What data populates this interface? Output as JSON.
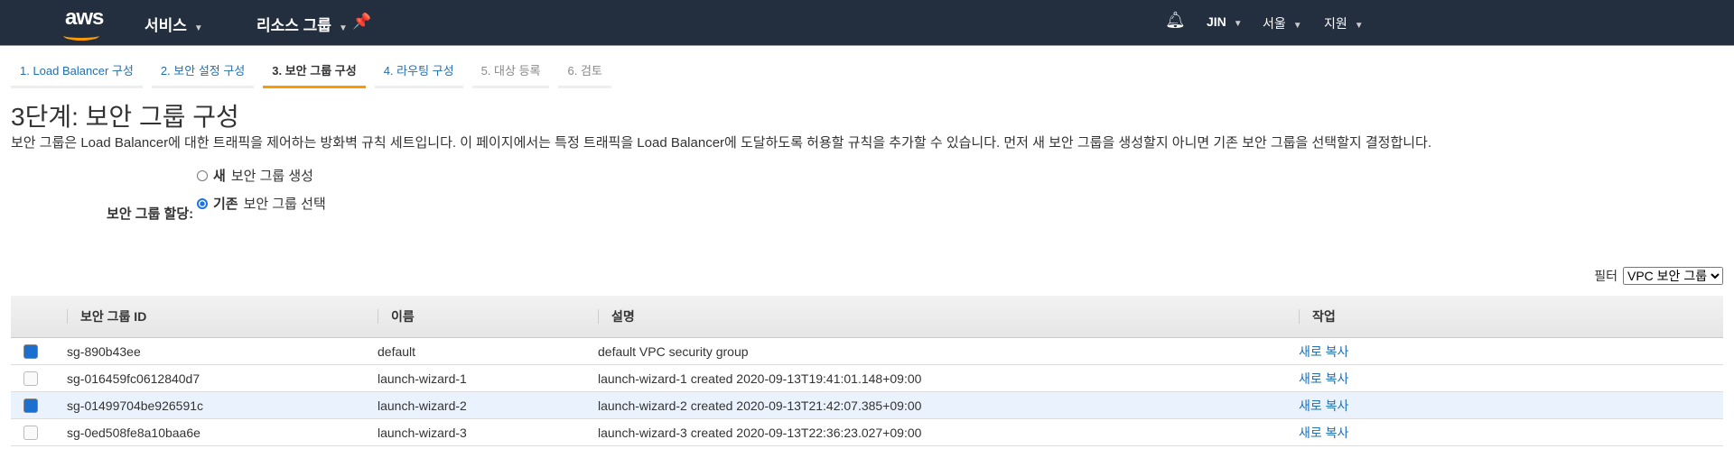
{
  "header": {
    "logo": "aws",
    "services": "서비스",
    "resource_groups": "리소스 그룹",
    "user": "JIN",
    "region": "서울",
    "support": "지원"
  },
  "steps": [
    "1. Load Balancer 구성",
    "2. 보안 설정 구성",
    "3. 보안 그룹 구성",
    "4. 라우팅 구성",
    "5. 대상 등록",
    "6. 검토"
  ],
  "title": "3단계: 보안 그룹 구성",
  "description": "보안 그룹은 Load Balancer에 대한 트래픽을 제어하는 방화벽 규칙 세트입니다. 이 페이지에서는 특정 트래픽을 Load Balancer에 도달하도록 허용할 규칙을 추가할 수 있습니다. 먼저 새 보안 그룹을 생성할지 아니면 기존 보안 그룹을 선택할지 결정합니다.",
  "assign": {
    "label": "보안 그룹 할당:",
    "new_bold": "새",
    "new_rest": "보안 그룹 생성",
    "existing_bold": "기존",
    "existing_rest": "보안 그룹 선택",
    "selected": "existing"
  },
  "filter": {
    "label": "필터",
    "value": "VPC 보안 그룹"
  },
  "table": {
    "columns": [
      "보안 그룹 ID",
      "이름",
      "설명",
      "작업"
    ],
    "rows": [
      {
        "checked": true,
        "id": "sg-890b43ee",
        "name": "default",
        "desc": "default VPC security group",
        "action": "새로 복사"
      },
      {
        "checked": false,
        "id": "sg-016459fc0612840d7",
        "name": "launch-wizard-1",
        "desc": "launch-wizard-1 created 2020-09-13T19:41:01.148+09:00",
        "action": "새로 복사"
      },
      {
        "checked": true,
        "id": "sg-01499704be926591c",
        "name": "launch-wizard-2",
        "desc": "launch-wizard-2 created 2020-09-13T21:42:07.385+09:00",
        "action": "새로 복사"
      },
      {
        "checked": false,
        "id": "sg-0ed508fe8a10baa6e",
        "name": "launch-wizard-3",
        "desc": "launch-wizard-3 created 2020-09-13T22:36:23.027+09:00",
        "action": "새로 복사"
      }
    ]
  }
}
